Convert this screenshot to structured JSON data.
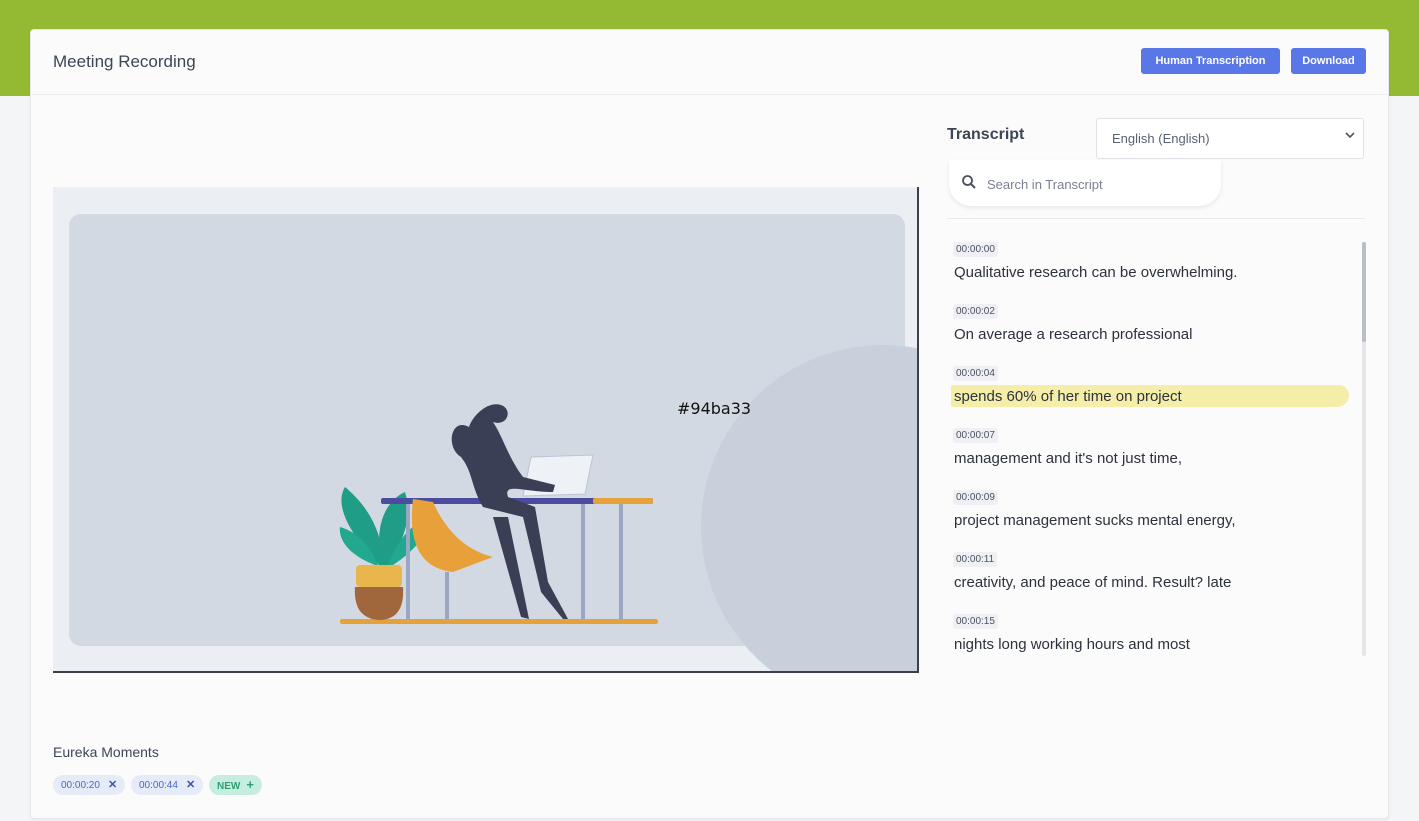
{
  "header": {
    "title": "Meeting Recording",
    "buttons": {
      "human_transcription": "Human Transcription",
      "download": "Download"
    }
  },
  "video": {
    "overlay_text": "#94ba33"
  },
  "transcript": {
    "label": "Transcript",
    "language": "English (English)",
    "search_placeholder": "Search in Transcript",
    "entries": [
      {
        "time": "00:00:00",
        "text": "Qualitative research can be overwhelming."
      },
      {
        "time": "00:00:02",
        "text": "On average a research professional"
      },
      {
        "time": "00:00:04",
        "text": "spends 60% of her time on project",
        "highlighted": true
      },
      {
        "time": "00:00:07",
        "text": "management and it's not just time,"
      },
      {
        "time": "00:00:09",
        "text": "project management sucks mental energy,"
      },
      {
        "time": "00:00:11",
        "text": "creativity, and peace of mind. Result? late"
      },
      {
        "time": "00:00:15",
        "text": "nights long working hours and most"
      }
    ]
  },
  "eureka": {
    "label": "Eureka Moments",
    "moments": [
      {
        "time": "00:00:20"
      },
      {
        "time": "00:00:44"
      }
    ],
    "new_label": "NEW"
  },
  "icons": {
    "search": "search-icon",
    "chevron": "chevron-down-icon",
    "remove": "close-icon",
    "add": "plus-icon"
  },
  "colors": {
    "topbar": "#94ba33",
    "primary_button": "#5a77e8",
    "highlight": "#f2eb9a",
    "new_chip": "#c6eee0"
  }
}
